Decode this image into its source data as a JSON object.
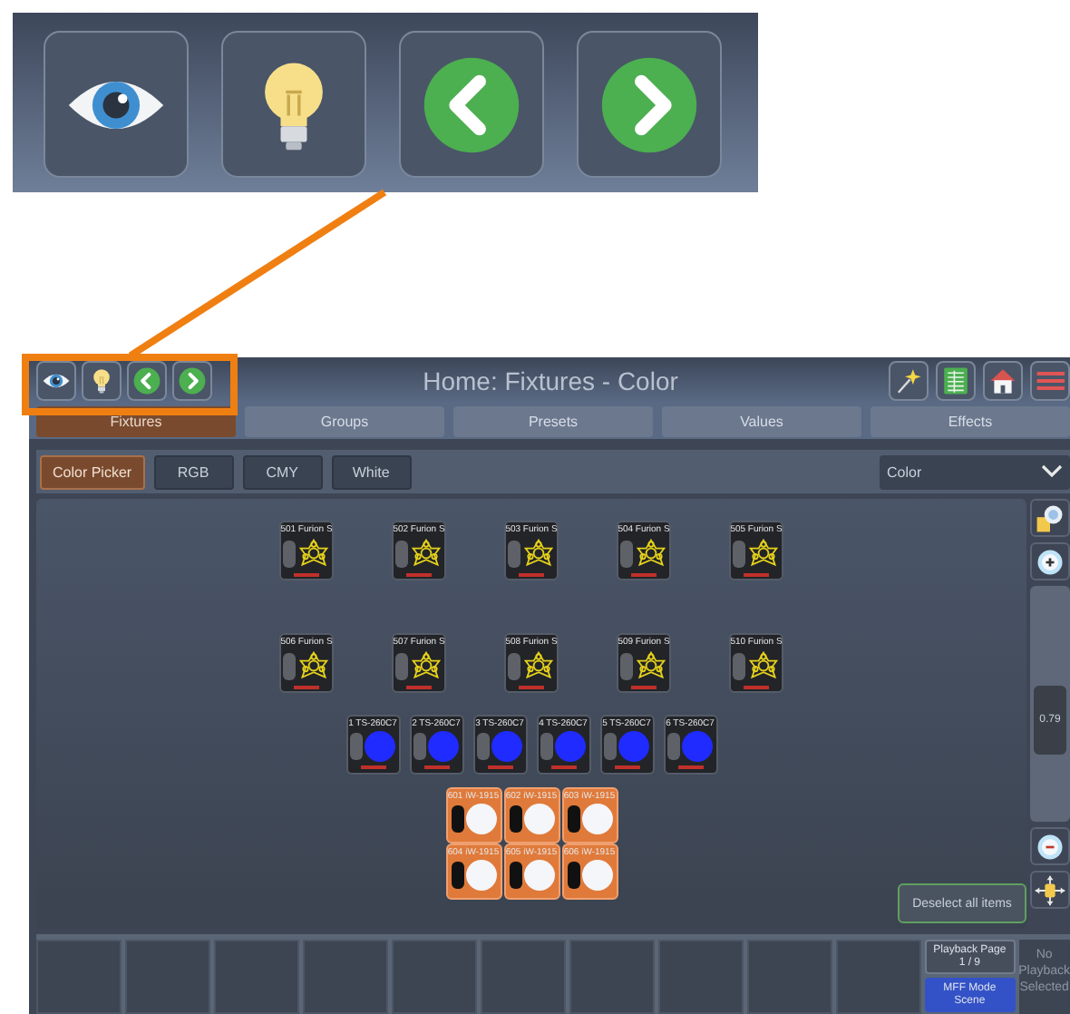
{
  "header": {
    "title": "Home: Fixtures - Color"
  },
  "tabs": [
    {
      "label": "Fixtures",
      "selected": true
    },
    {
      "label": "Groups",
      "selected": false
    },
    {
      "label": "Presets",
      "selected": false
    },
    {
      "label": "Values",
      "selected": false
    },
    {
      "label": "Effects",
      "selected": false
    }
  ],
  "subtabs": [
    {
      "label": "Color Picker",
      "selected": true
    },
    {
      "label": "RGB",
      "selected": false
    },
    {
      "label": "CMY",
      "selected": false
    },
    {
      "label": "White",
      "selected": false
    }
  ],
  "dropdown": {
    "value": "Color"
  },
  "fixture_rows": [
    {
      "fixtures": [
        {
          "label": "501 Furion S",
          "kind": "gobo",
          "selected": false
        },
        {
          "label": "502 Furion S",
          "kind": "gobo",
          "selected": false
        },
        {
          "label": "503 Furion S",
          "kind": "gobo",
          "selected": false
        },
        {
          "label": "504 Furion S",
          "kind": "gobo",
          "selected": false
        },
        {
          "label": "505 Furion S",
          "kind": "gobo",
          "selected": false
        }
      ]
    },
    {
      "fixtures": [
        {
          "label": "506 Furion S",
          "kind": "gobo",
          "selected": false
        },
        {
          "label": "507 Furion S",
          "kind": "gobo",
          "selected": false
        },
        {
          "label": "508 Furion S",
          "kind": "gobo",
          "selected": false
        },
        {
          "label": "509 Furion S",
          "kind": "gobo",
          "selected": false
        },
        {
          "label": "510 Furion S",
          "kind": "gobo",
          "selected": false
        }
      ]
    },
    {
      "fixtures": [
        {
          "label": "1 TS-260C7",
          "kind": "dot",
          "color": "#1f2bff",
          "selected": false
        },
        {
          "label": "2 TS-260C7",
          "kind": "dot",
          "color": "#1f2bff",
          "selected": false
        },
        {
          "label": "3 TS-260C7",
          "kind": "dot",
          "color": "#1f2bff",
          "selected": false
        },
        {
          "label": "4 TS-260C7",
          "kind": "dot",
          "color": "#1f2bff",
          "selected": false
        },
        {
          "label": "5 TS-260C7",
          "kind": "dot",
          "color": "#1f2bff",
          "selected": false
        },
        {
          "label": "6 TS-260C7",
          "kind": "dot",
          "color": "#1f2bff",
          "selected": false
        }
      ]
    },
    {
      "fixtures": [
        {
          "label": "601 iW-1915",
          "kind": "dot",
          "color": "#f4f6fa",
          "selected": true
        },
        {
          "label": "602 iW-1915",
          "kind": "dot",
          "color": "#f4f6fa",
          "selected": true
        },
        {
          "label": "603 iW-1915",
          "kind": "dot",
          "color": "#f4f6fa",
          "selected": true
        }
      ]
    },
    {
      "fixtures": [
        {
          "label": "604 iW-1915",
          "kind": "dot",
          "color": "#f4f6fa",
          "selected": true
        },
        {
          "label": "605 iW-1915",
          "kind": "dot",
          "color": "#f4f6fa",
          "selected": true
        },
        {
          "label": "606 iW-1915",
          "kind": "dot",
          "color": "#f4f6fa",
          "selected": true
        }
      ]
    }
  ],
  "zoom": {
    "reading": "0.79",
    "level": 0.4
  },
  "deselect_button": "Deselect all items",
  "playback": {
    "page_label": "Playback Page",
    "page": "1 / 9",
    "mode_label": "MFF Mode",
    "mode": "Scene",
    "status": "No Playback Selected"
  }
}
